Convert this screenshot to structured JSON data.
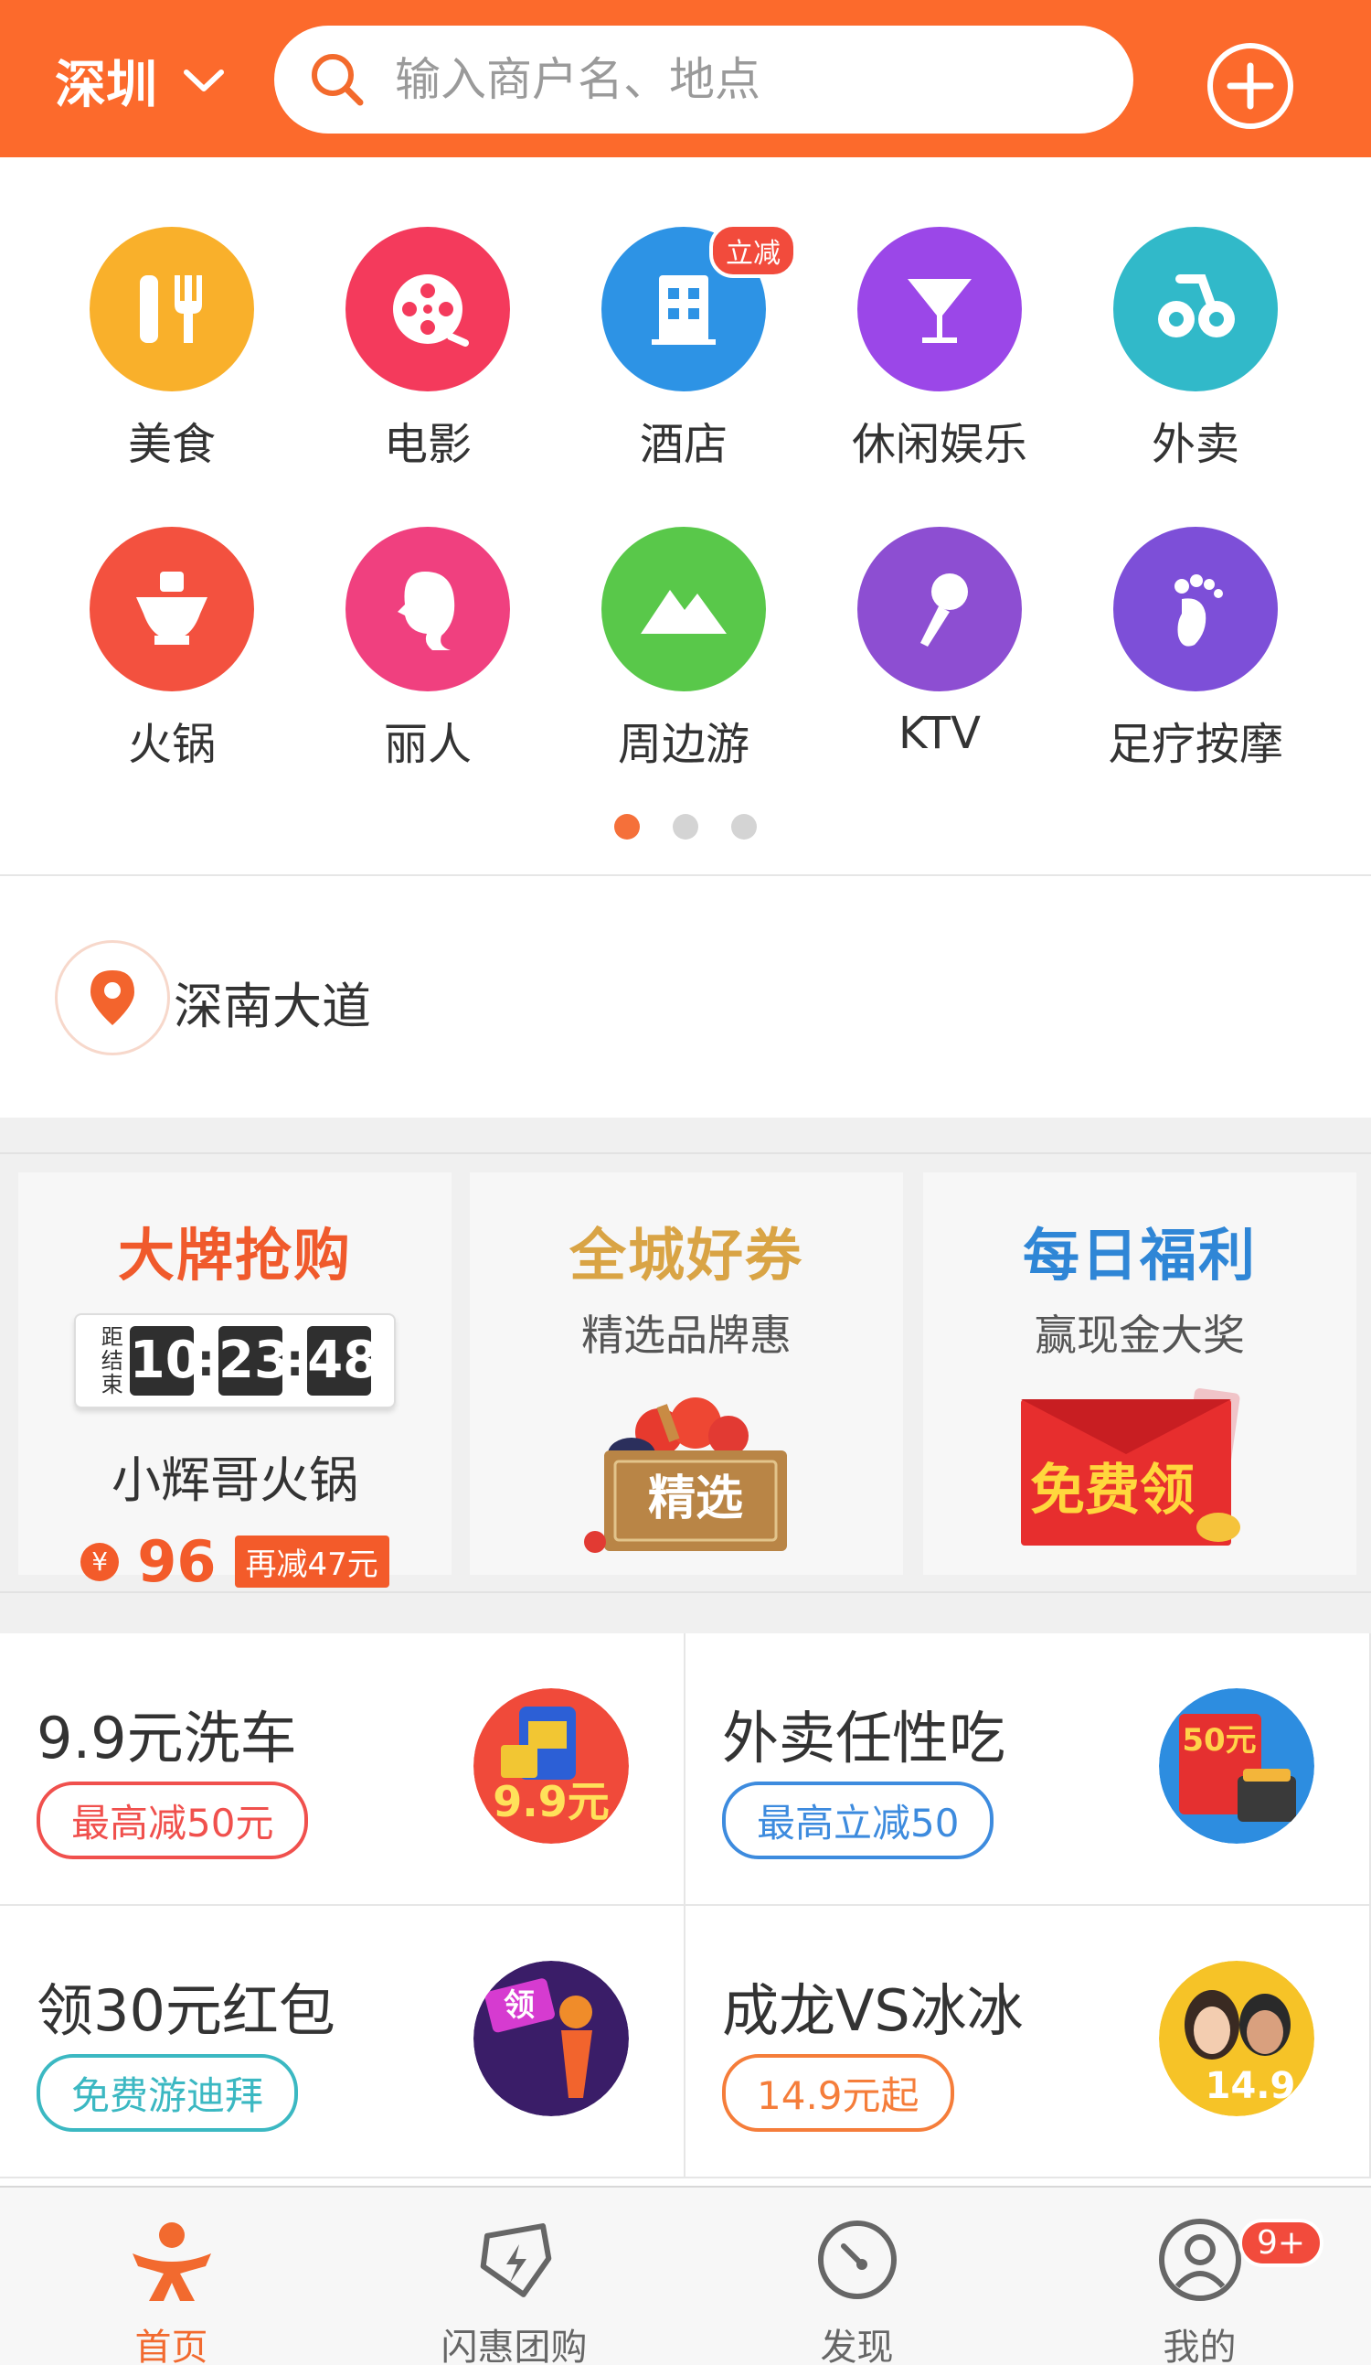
{
  "header": {
    "city": "深圳",
    "search_placeholder": "输入商户名、地点"
  },
  "categories": [
    {
      "label": "美食",
      "icon": "food-icon",
      "color": "#f9b02b"
    },
    {
      "label": "电影",
      "icon": "movie-icon",
      "color": "#f43a5c"
    },
    {
      "label": "酒店",
      "icon": "hotel-icon",
      "color": "#2d93e5",
      "badge": "立减"
    },
    {
      "label": "休闲娱乐",
      "icon": "cocktail-icon",
      "color": "#9b47e8"
    },
    {
      "label": "外卖",
      "icon": "takeout-icon",
      "color": "#31b9c9"
    },
    {
      "label": "火锅",
      "icon": "hotpot-icon",
      "color": "#f3513f"
    },
    {
      "label": "丽人",
      "icon": "beauty-icon",
      "color": "#f0407f"
    },
    {
      "label": "周边游",
      "icon": "mountain-icon",
      "color": "#59c84a"
    },
    {
      "label": "KTV",
      "icon": "microphone-icon",
      "color": "#8d4ed2"
    },
    {
      "label": "足疗按摩",
      "icon": "footprint-icon",
      "color": "#7d4fd8"
    }
  ],
  "pager": {
    "count": 3,
    "active": 0
  },
  "location": {
    "text": "深南大道"
  },
  "promos": {
    "flash": {
      "title": "大牌抢购",
      "timer_label": "距结束",
      "hours": "10",
      "minutes": "23",
      "seconds": "48",
      "shop": "小辉哥火锅",
      "currency": "¥",
      "price": "96",
      "extra": "再减47元"
    },
    "coupon": {
      "title": "全城好券",
      "subtitle": "精选品牌惠",
      "stamp": "精选"
    },
    "daily": {
      "title": "每日福利",
      "subtitle": "赢现金大奖",
      "envelope": "免费领"
    }
  },
  "deals": [
    {
      "title": "9.9元洗车",
      "tag": "最高减50元",
      "tag_color": "#f0504d",
      "pic_text": "9.9元"
    },
    {
      "title": "外卖任性吃",
      "tag": "最高立减50",
      "tag_color": "#3d8bde",
      "pic_text": "50元"
    },
    {
      "title": "领30元红包",
      "tag": "免费游迪拜",
      "tag_color": "#3bb8c2",
      "pic_text": "领"
    },
    {
      "title": "成龙VS冰冰",
      "tag": "14.9元起",
      "tag_color": "#f57d3a",
      "pic_text": "14.9"
    }
  ],
  "tabs": [
    {
      "label": "首页",
      "icon": "home-icon",
      "active": true
    },
    {
      "label": "闪惠团购",
      "icon": "flash-deal-icon"
    },
    {
      "label": "发现",
      "icon": "discover-icon"
    },
    {
      "label": "我的",
      "icon": "profile-icon",
      "badge": "9+"
    }
  ],
  "colors": {
    "brand": "#fc6a2c",
    "accent": "#f35b2a"
  }
}
